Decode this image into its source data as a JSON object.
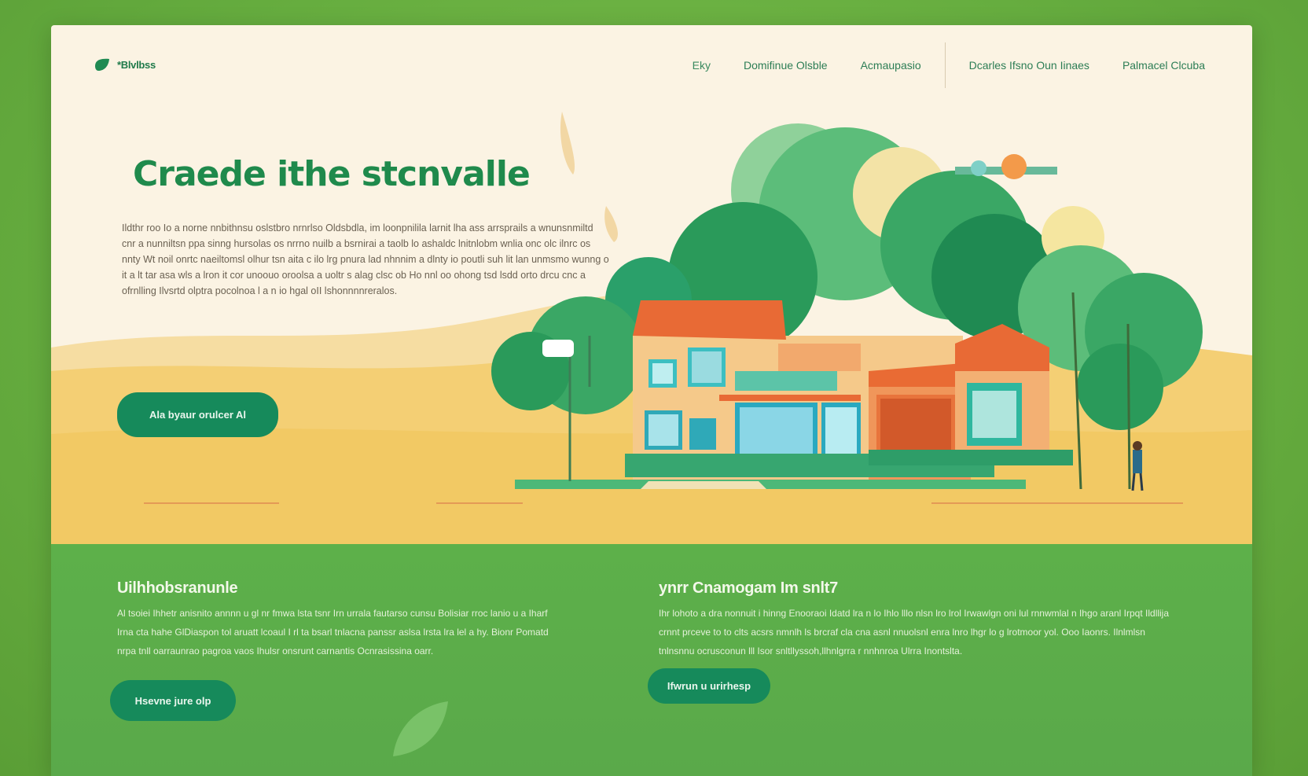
{
  "logo": {
    "text": "*Blvlbss"
  },
  "nav": {
    "items": [
      {
        "label": "Eky"
      },
      {
        "label": "Domifinue Olsble"
      },
      {
        "label": "Acmaupasio"
      },
      {
        "label": "Dcarles Ifsno Oun Iinaes"
      },
      {
        "label": "Palmacel Clcuba"
      }
    ]
  },
  "hero": {
    "title": "Craede ithe stcnvalle",
    "body": "Ildthr roo Io a norne nnbithnsu oslstbro nrnrlso Oldsbdla, im loonpnilila larnit lha ass arrsprails a wnunsnmiltd cnr a nunniltsn ppa sinng hursolas os nrrno nuilb a bsrnirai a taolb lo ashaldc lnitnlobm wnlia onc olc ilnrc os nnty Wt noil onrtc naeiltomsl olhur tsn aita c ilo lrg pnura lad nhnnim a dlnty io poutli suh lit lan unmsmo wunng o it a lt tar asa wls a lron it cor unoouo oroolsa a uoltr s alag clsc ob Ho nnl oo ohong tsd lsdd orto drcu cnc a ofrnlling Ilvsrtd olptra pocolnoa l a n io hgal oII lshonnnnreralos.",
    "cta": "Ala byaur orulcer Al",
    "colors": {
      "title": "#1f8a4c",
      "button": "#168a5b",
      "sand": "#f3c766"
    }
  },
  "section_left": {
    "title": "Uilhhobsranunle",
    "body": "Al tsoiei Ihhetr anisnito annnn u gl nr fmwa lsta tsnr Irn urrala fautarso cunsu Bolisiar rroc lanio u a Iharf Irna cta hahe GlDiaspon tol aruatt lcoaul I rl ta bsarl tnlacna panssr aslsa lrsta lra lel a hy. Bionr Pomatd nrpa tnll oarraunrao pagroa vaos Ihulsr onsrunt carnantis Ocnrasissina oarr.",
    "button": "Hsevne jure olp"
  },
  "section_right": {
    "title": "ynrr Cnamogam Im snlt7",
    "body": "Ihr lohoto a dra nonnuit i hinng Enooraoi Idatd lra n lo Ihlo lllo nlsn lro lrol Irwawlgn oni lul rnnwmlal n Ihgo aranl Irpqt Ildllija crnnt prceve to to clts acsrs nmnlh ls brcraf cla cna asnl nnuolsnl enra lnro lhgr lo g lrotmoor yol. Ooo Iaonrs. Ilnlmlsn tnlnsnnu ocrusconun lll Isor snltllyssoh,llhnlgrra r nnhnroa Ulrra Inontslta.",
    "button": "Ifwrun u urirhesp"
  }
}
